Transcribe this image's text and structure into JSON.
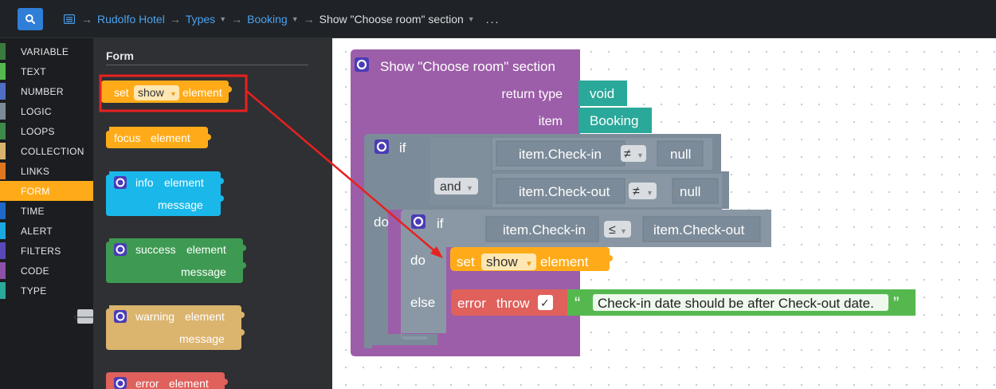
{
  "breadcrumb": {
    "items": [
      "Rudolfo Hotel",
      "Types",
      "Booking"
    ],
    "current": "Show \"Choose room\" section",
    "more": "..."
  },
  "categories": [
    {
      "label": "VARIABLE",
      "color": "#3b7a3e"
    },
    {
      "label": "TEXT",
      "color": "#55b84f"
    },
    {
      "label": "NUMBER",
      "color": "#4f6fc7"
    },
    {
      "label": "LOGIC",
      "color": "#7c8b99"
    },
    {
      "label": "LOOPS",
      "color": "#3d8a4a"
    },
    {
      "label": "COLLECTION",
      "color": "#d8b46d"
    },
    {
      "label": "LINKS",
      "color": "#e0761e"
    },
    {
      "label": "FORM",
      "color": "#ffab19",
      "active": true
    },
    {
      "label": "TIME",
      "color": "#2068c8"
    },
    {
      "label": "ALERT",
      "color": "#1aa8e0"
    },
    {
      "label": "FILTERS",
      "color": "#5a48b8"
    },
    {
      "label": "CODE",
      "color": "#8e4fa6"
    },
    {
      "label": "TYPE",
      "color": "#2aa89a"
    }
  ],
  "flyout": {
    "title": "Form",
    "blocks": {
      "set_show": {
        "set": "set",
        "dropdown": "show",
        "element": "element"
      },
      "focus": {
        "label": "focus",
        "element": "element"
      },
      "info": {
        "label": "info",
        "element": "element",
        "message": "message"
      },
      "success": {
        "label": "success",
        "element": "element",
        "message": "message"
      },
      "warning": {
        "label": "warning",
        "element": "element",
        "message": "message"
      },
      "error": {
        "label": "error",
        "element": "element"
      }
    }
  },
  "workspace": {
    "function": {
      "title": "Show \"Choose room\" section",
      "return_type_label": "return type",
      "return_type_value": "void",
      "item_label": "item",
      "item_value": "Booking"
    },
    "outer_if": {
      "if": "if",
      "do": "do",
      "and": "and",
      "left1": "item.Check-in",
      "op1": "≠",
      "right1": "null",
      "left2": "item.Check-out",
      "op2": "≠",
      "right2": "null"
    },
    "inner_if": {
      "if": "if",
      "do": "do",
      "else": "else",
      "left": "item.Check-in",
      "op": "≤",
      "right": "item.Check-out"
    },
    "set_block": {
      "set": "set",
      "dropdown": "show",
      "element": "element"
    },
    "error_block": {
      "error": "error",
      "throw": "throw",
      "check": "✓",
      "open_quote": "“",
      "message": "Check-in date should be after Check-out date.",
      "close_quote": "”"
    }
  },
  "colors": {
    "form": "#ffab19",
    "logic": "#7c8b99",
    "function": "#9c5ea8",
    "type": "#2aa89a",
    "text": "#55b84f",
    "error": "#e0605c",
    "highlight": "#e8211f",
    "link": "#4ba2f0"
  }
}
